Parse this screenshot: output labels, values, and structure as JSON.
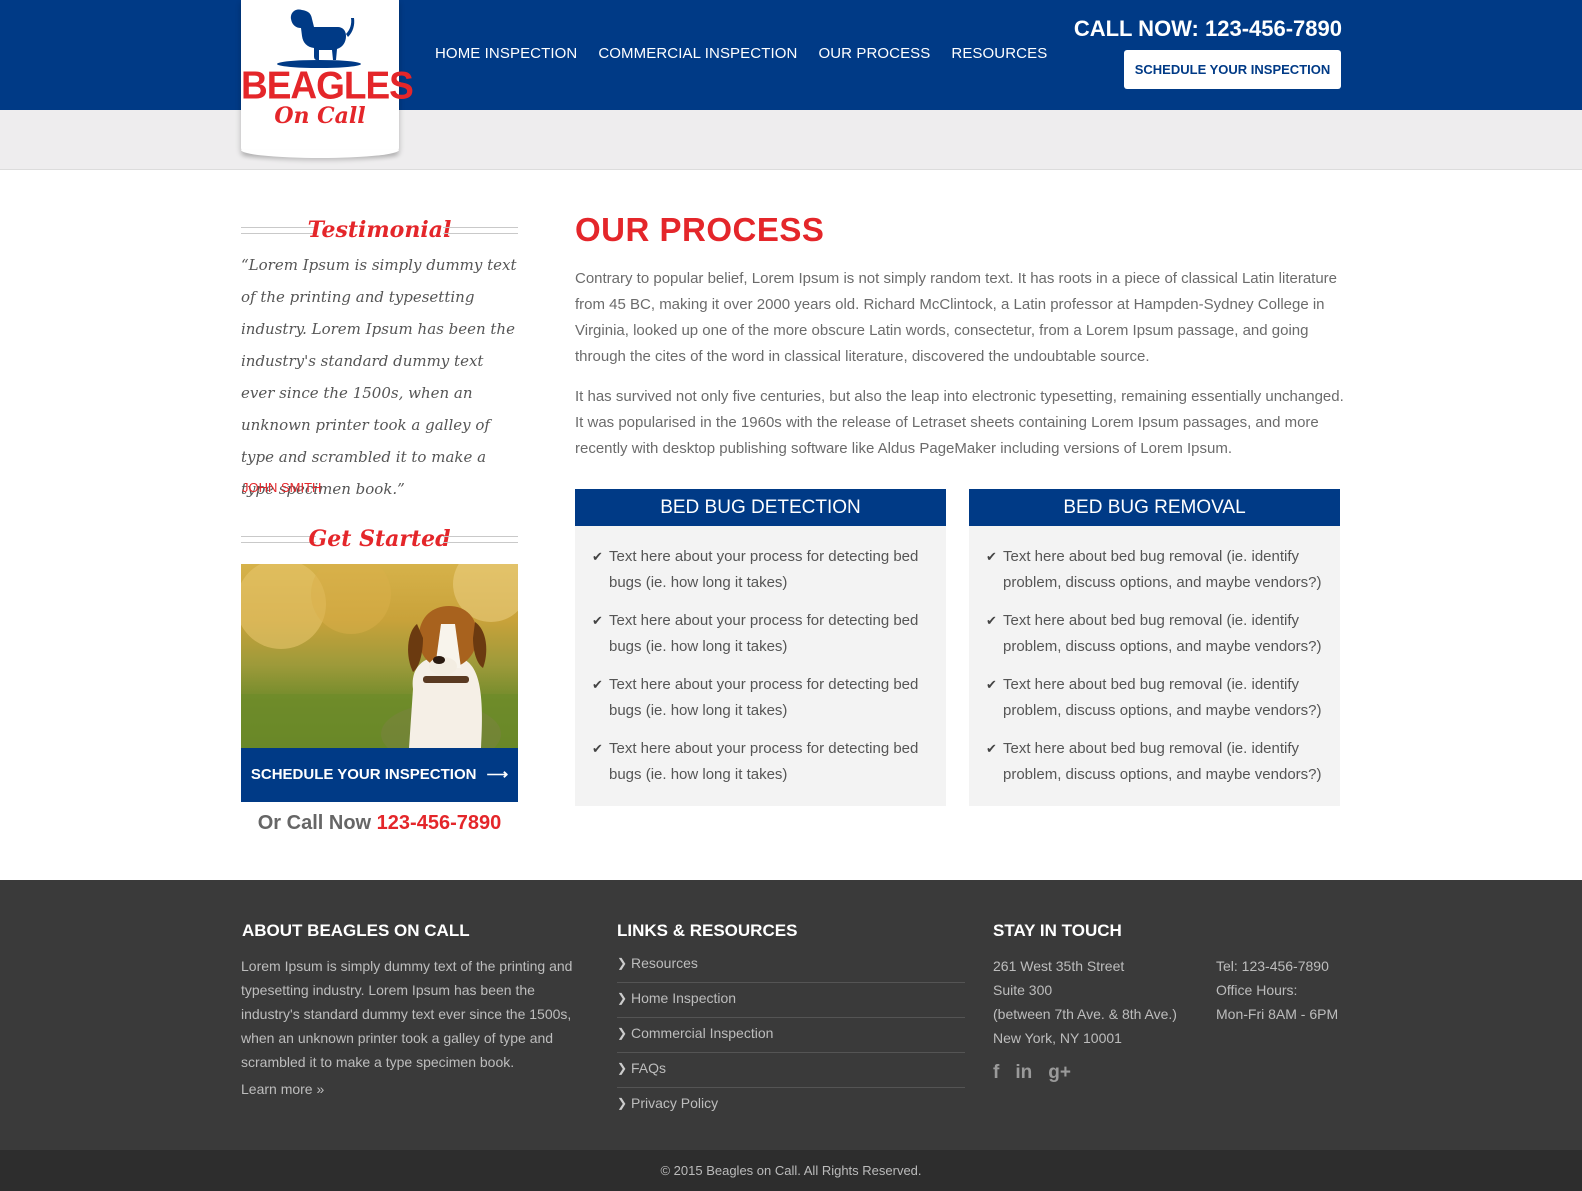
{
  "header": {
    "logo": {
      "main": "BEAGLES",
      "sub": "On Call"
    },
    "nav": [
      "HOME INSPECTION",
      "COMMERCIAL INSPECTION",
      "OUR PROCESS",
      "RESOURCES"
    ],
    "call_now": "CALL NOW: 123-456-7890",
    "schedule_button": "SCHEDULE YOUR INSPECTION"
  },
  "sidebar": {
    "testimonial": {
      "heading": "Testimonial",
      "quote": "“Lorem Ipsum is simply dummy text of the printing and typesetting industry. Lorem Ipsum has been the industry's standard dummy text ever since the 1500s, when an unknown printer took a galley of type and scrambled it to make a type specimen book.”",
      "author": "JOHN SMITH"
    },
    "get_started": {
      "heading": "Get Started",
      "button": "SCHEDULE YOUR INSPECTION",
      "or_call_label": "Or Call Now",
      "or_call_number": "123-456-7890"
    }
  },
  "main": {
    "title": "OUR PROCESS",
    "paragraphs": [
      "Contrary to popular belief, Lorem Ipsum is not simply random text. It has roots in a piece of classical Latin literature from 45 BC, making it over 2000 years old. Richard McClintock, a Latin professor at Hampden-Sydney College in Virginia, looked up one of the more obscure Latin words, consectetur, from a Lorem Ipsum passage, and going through the cites of the word in classical literature, discovered the undoubtable source.",
      "It has survived not only five centuries, but also the leap into electronic typesetting, remaining essentially unchanged. It was popularised in the 1960s with the release of Letraset sheets containing Lorem Ipsum passages, and more recently with desktop publishing software like Aldus PageMaker including versions of Lorem Ipsum."
    ],
    "panels": [
      {
        "title": "BED BUG DETECTION",
        "items": [
          "Text here about your process for detecting bed bugs (ie. how long it takes)",
          "Text here about your process for detecting bed bugs (ie. how long it takes)",
          "Text here about your process for detecting bed bugs (ie. how long it takes)",
          "Text here about your process for detecting bed bugs (ie. how long it takes)"
        ]
      },
      {
        "title": "BED BUG REMOVAL",
        "items": [
          "Text here about bed bug removal (ie. identify problem, discuss options, and maybe vendors?)",
          "Text here about bed bug removal (ie. identify problem, discuss options, and maybe vendors?)",
          "Text here about bed bug removal (ie. identify problem, discuss options, and maybe vendors?)",
          "Text here about bed bug removal (ie. identify problem, discuss options, and maybe vendors?)"
        ]
      }
    ]
  },
  "footer": {
    "about": {
      "title": "ABOUT BEAGLES ON CALL",
      "text": "Lorem Ipsum is simply dummy text of the printing and typesetting industry. Lorem Ipsum has been the industry's standard dummy text ever since the 1500s, when an unknown printer took a galley of type and scrambled it to make a type specimen book.",
      "learn_more": "Learn more »"
    },
    "links": {
      "title": "LINKS & RESOURCES",
      "items": [
        "Resources",
        "Home Inspection",
        "Commercial Inspection",
        "FAQs",
        "Privacy Policy"
      ]
    },
    "contact": {
      "title": "STAY IN TOUCH",
      "address": [
        "261 West 35th Street",
        "Suite 300",
        "(between 7th Ave. & 8th Ave.)",
        "New York, NY 10001"
      ],
      "phone_hours": [
        "Tel: 123-456-7890",
        "Office Hours:",
        "Mon-Fri 8AM - 6PM"
      ],
      "social_icons": [
        "facebook-icon",
        "linkedin-icon",
        "google-plus-icon"
      ]
    },
    "copyright": "© 2015 Beagles on Call. All Rights Reserved."
  },
  "colors": {
    "brand_blue": "#003a86",
    "brand_red": "#e4262a",
    "footer_bg": "#3a3a3a"
  }
}
